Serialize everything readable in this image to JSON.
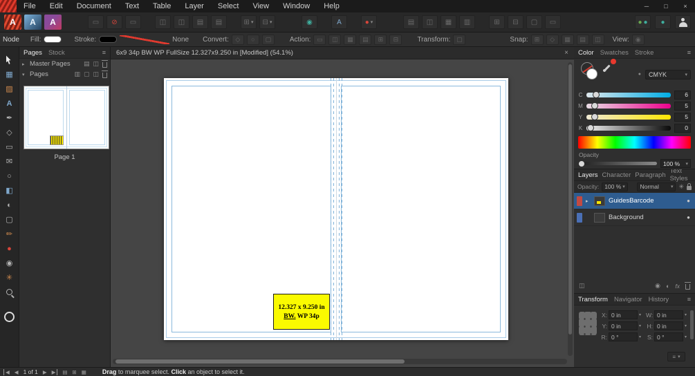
{
  "window_controls": {
    "minimize": "─",
    "maximize": "□",
    "close": "×"
  },
  "menubar": {
    "items": [
      "File",
      "Edit",
      "Document",
      "Text",
      "Table",
      "Layer",
      "Select",
      "View",
      "Window",
      "Help"
    ]
  },
  "context_toolbar": {
    "tool_name": "Node",
    "fill_label": "Fill:",
    "stroke_label": "Stroke:",
    "stroke_style_value": "None",
    "convert_label": "Convert:",
    "action_label": "Action:",
    "transform_label": "Transform:",
    "snap_label": "Snap:",
    "view_label": "View:"
  },
  "pages_panel": {
    "tab_pages": "Pages",
    "tab_stock": "Stock",
    "master_pages_label": "Master Pages",
    "pages_label": "Pages",
    "page1_label": "Page 1"
  },
  "document": {
    "tab_title": "6x9 34p BW WP FullSize 12.327x9.250 in [Modified] (54.1%)",
    "info_line1": "12.327 x 9.250 in",
    "info_line2_bw": "BW.",
    "info_line2_rest": " WP 34p"
  },
  "color_panel": {
    "tabs": [
      "Color",
      "Swatches",
      "Stroke"
    ],
    "mode": "CMYK",
    "sliders": [
      {
        "label": "C",
        "value": "6"
      },
      {
        "label": "M",
        "value": "5"
      },
      {
        "label": "Y",
        "value": "5"
      },
      {
        "label": "K",
        "value": "0"
      }
    ],
    "opacity_label": "Opacity",
    "opacity_value": "100 %"
  },
  "layers_panel": {
    "tabs": [
      "Layers",
      "Character",
      "Paragraph",
      "Text Styles"
    ],
    "opacity_label": "Opacity:",
    "opacity_value": "100 %",
    "blend_mode": "Normal",
    "layers": [
      {
        "name": "GuidesBarcode"
      },
      {
        "name": "Background"
      }
    ]
  },
  "transform_panel": {
    "tabs": [
      "Transform",
      "Navigator",
      "History"
    ],
    "fields": [
      {
        "label": "X:",
        "value": "0 in"
      },
      {
        "label": "W:",
        "value": "0 in"
      },
      {
        "label": "Y:",
        "value": "0 in"
      },
      {
        "label": "H:",
        "value": "0 in"
      },
      {
        "label": "R:",
        "value": "0 °"
      },
      {
        "label": "S:",
        "value": "0 °"
      }
    ]
  },
  "status_bar": {
    "page_indicator": "1 of 1",
    "hint_bold1": "Drag",
    "hint_text1": " to marquee select. ",
    "hint_bold2": "Click",
    "hint_text2": " an object to select it."
  },
  "icons": {
    "hamburger": "≡",
    "chevron": "▾",
    "tri_right": "▸",
    "tri_down": "▾",
    "close": "×",
    "prev": "◀",
    "next": "▶",
    "none": "⊘",
    "grid": "▦",
    "frame": "▨",
    "letter_a": "A",
    "pen": "✒",
    "diamond": "◇",
    "rect": "▭",
    "envelope": "✉",
    "circle": "○",
    "gradient": "◧",
    "half_circle": "◐",
    "square": "▢",
    "pencil": "✏",
    "dot": "●",
    "target": "◉",
    "star": "✳",
    "pages": "▤",
    "columns": "◫",
    "rows": "▥",
    "plus_box": "⊞",
    "minus_box": "⊟",
    "fx": "fx"
  },
  "colors": {
    "selection_blue": "#2e5c8f",
    "guide_blue": "#8ab9dc",
    "info_yellow": "#fafa00",
    "logo_red": "#d93a2b"
  }
}
